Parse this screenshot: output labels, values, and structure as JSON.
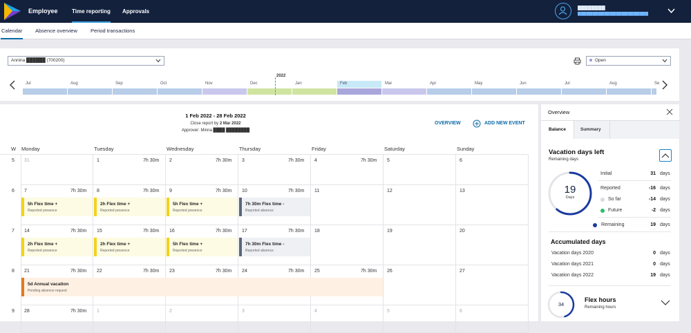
{
  "header": {
    "app_name": "Employee",
    "nav": [
      "Time reporting",
      "Approvals"
    ],
    "user_name": "████████",
    "user_org": "████████████████████████"
  },
  "subnav": {
    "tabs": [
      "Calendar",
      "Absence overview",
      "Period transactions"
    ]
  },
  "filter": {
    "employee": "Annina ██████ (700200)",
    "status": "Open",
    "year_label": "2022"
  },
  "timeline": {
    "months": [
      "Jul",
      "Aug",
      "Sep",
      "Oct",
      "Nov",
      "Dec",
      "Jan",
      "Feb",
      "Mar",
      "Apr",
      "May",
      "Jun",
      "Jul",
      "Aug",
      "Se"
    ],
    "colors": [
      "#b7cde8",
      "#b7cde8",
      "#b7cde8",
      "#b7cde8",
      "#c9c8ec",
      "#cfe4a0",
      "#cfe4a0",
      "#a9a6dc",
      "#c9c8ec",
      "#b7cde8",
      "#b7cde8",
      "#b7cde8",
      "#b7cde8",
      "#b7cde8",
      "#b7cde8"
    ]
  },
  "calendar": {
    "period": "1 Feb 2022 - 28 Feb 2022",
    "close_prefix": "Close report by",
    "close_date": "2 Mar 2022",
    "approver": "Approver: Minna ████ ████████",
    "overview_label": "OVERVIEW",
    "add_event_label": "ADD NEW EVENT",
    "week_header": "W",
    "days_of_week": [
      "Monday",
      "Tuesday",
      "Wednesday",
      "Thursday",
      "Friday",
      "Saturday",
      "Sunday"
    ],
    "weeks": [
      {
        "week": "5",
        "days": [
          {
            "num": "31",
            "grey": true,
            "hrs": ""
          },
          {
            "num": "1",
            "hrs": "7h 30m"
          },
          {
            "num": "2",
            "hrs": "7h 30m"
          },
          {
            "num": "3",
            "hrs": "7h 30m"
          },
          {
            "num": "4",
            "hrs": "7h 30m"
          },
          {
            "num": "5",
            "hrs": ""
          },
          {
            "num": "6",
            "hrs": ""
          }
        ]
      },
      {
        "week": "6",
        "days": [
          {
            "num": "7",
            "hrs": "7h 30m",
            "event": {
              "title": "5h Flex time +",
              "sub": "Reported presence",
              "kind": "flex"
            }
          },
          {
            "num": "8",
            "hrs": "7h 30m",
            "event": {
              "title": "2h Flex time +",
              "sub": "Reported presence",
              "kind": "flex"
            }
          },
          {
            "num": "9",
            "hrs": "7h 30m",
            "event": {
              "title": "5h Flex time +",
              "sub": "Reported presence",
              "kind": "flex"
            }
          },
          {
            "num": "10",
            "hrs": "7h 30m",
            "event": {
              "title": "7h 30m Flex time -",
              "sub": "Reported absence",
              "kind": "abs"
            }
          },
          {
            "num": "11",
            "hrs": ""
          },
          {
            "num": "12",
            "hrs": ""
          },
          {
            "num": "13",
            "hrs": ""
          }
        ]
      },
      {
        "week": "7",
        "days": [
          {
            "num": "14",
            "hrs": "7h 30m",
            "event": {
              "title": "2h Flex time +",
              "sub": "Reported presence",
              "kind": "flex"
            }
          },
          {
            "num": "15",
            "hrs": "7h 30m",
            "event": {
              "title": "2h Flex time +",
              "sub": "Reported presence",
              "kind": "flex"
            }
          },
          {
            "num": "16",
            "hrs": "7h 30m",
            "event": {
              "title": "5h Flex time +",
              "sub": "Reported presence",
              "kind": "flex"
            }
          },
          {
            "num": "17",
            "hrs": "7h 30m",
            "event": {
              "title": "7h 30m Flex time -",
              "sub": "Reported absence",
              "kind": "abs"
            }
          },
          {
            "num": "18",
            "hrs": ""
          },
          {
            "num": "19",
            "hrs": ""
          },
          {
            "num": "20",
            "hrs": ""
          }
        ]
      },
      {
        "week": "8",
        "days": [
          {
            "num": "21",
            "hrs": "7h 30m"
          },
          {
            "num": "22",
            "hrs": "7h 30m"
          },
          {
            "num": "23",
            "hrs": "7h 30m"
          },
          {
            "num": "24",
            "hrs": "7h 30m"
          },
          {
            "num": "25",
            "hrs": "7h 30m"
          },
          {
            "num": "26",
            "hrs": ""
          },
          {
            "num": "27",
            "hrs": ""
          }
        ],
        "span_event": {
          "title": "5d Annual vacation",
          "sub": "Pending absence request"
        }
      },
      {
        "week": "9",
        "days": [
          {
            "num": "28",
            "hrs": "7h 30m"
          },
          {
            "num": "1",
            "grey": true,
            "hrs": ""
          },
          {
            "num": "2",
            "grey": true,
            "hrs": ""
          },
          {
            "num": "3",
            "grey": true,
            "hrs": ""
          },
          {
            "num": "4",
            "grey": true,
            "hrs": ""
          },
          {
            "num": "5",
            "grey": true,
            "hrs": ""
          },
          {
            "num": "6",
            "grey": true,
            "hrs": ""
          }
        ]
      }
    ]
  },
  "overview": {
    "title": "Overview",
    "tabs": [
      "Balance",
      "Summary"
    ],
    "vacation_title": "Vacation days left",
    "vacation_sub": "Remaining days",
    "donut_value": "19",
    "donut_unit": "Days",
    "donut_fraction": 0.61,
    "rows": [
      {
        "label": "Initial",
        "value": "31",
        "unit": "days"
      },
      {
        "label": "Reported",
        "value": "-16",
        "unit": "days"
      },
      {
        "label": "So far",
        "value": "-14",
        "unit": "days"
      },
      {
        "label": "Future",
        "value": "-2",
        "unit": "days"
      },
      {
        "label": "Remaining",
        "value": "19",
        "unit": "days"
      }
    ],
    "accumulated_title": "Accumulated days",
    "accumulated": [
      {
        "label": "Vacation days 2020",
        "value": "0",
        "unit": "days"
      },
      {
        "label": "Vacation days 2021",
        "value": "0",
        "unit": "days"
      },
      {
        "label": "Vacation days 2022",
        "value": "19",
        "unit": "days"
      }
    ],
    "flex_title": "Flex hours",
    "flex_sub": "Remaining hours",
    "flex_value": "34",
    "flex_fraction": 0.45
  },
  "colors": {
    "navy": "#13213d",
    "accent": "#0b6aa8",
    "flex": "#f2d21f",
    "absence": "#5a6677",
    "vacation": "#e27a1f",
    "donut": "#1a3aa0",
    "future": "#2bc06b"
  }
}
